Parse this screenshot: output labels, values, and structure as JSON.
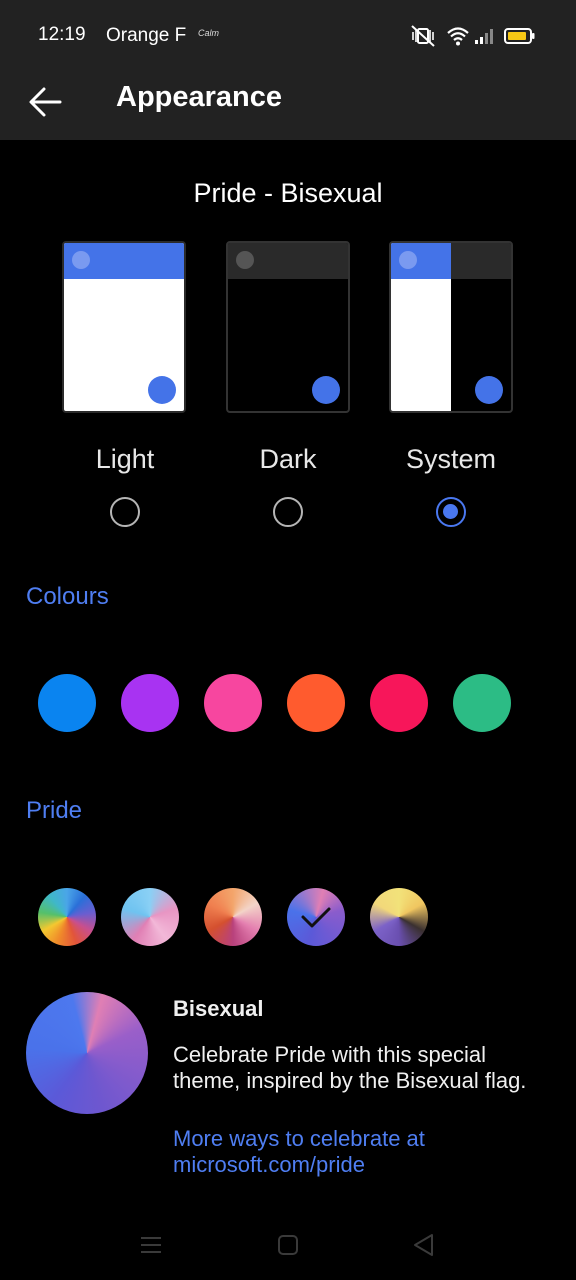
{
  "status_bar": {
    "time": "12:19",
    "carrier": "Orange F",
    "extra": "Calm"
  },
  "app_bar": {
    "title": "Appearance",
    "back_icon": "arrow-left-icon"
  },
  "theme": {
    "current_name": "Pride - Bisexual",
    "options": [
      {
        "label": "Light",
        "selected": false
      },
      {
        "label": "Dark",
        "selected": false
      },
      {
        "label": "System",
        "selected": true
      }
    ]
  },
  "colours": {
    "title": "Colours",
    "swatches": [
      "#0a84f0",
      "#a833f2",
      "#f7469f",
      "#ff5b2e",
      "#f7165a",
      "#2cbc85"
    ]
  },
  "pride": {
    "title": "Pride",
    "swatches": [
      "rainbow",
      "trans",
      "lesbian",
      "bisexual",
      "nonbinary"
    ],
    "selected_index": 3
  },
  "detail": {
    "title": "Bisexual",
    "description": "Celebrate Pride with this special theme, inspired by the Bisexual flag.",
    "link": "More ways to celebrate at microsoft.com/pride"
  },
  "colors": {
    "accent": "#4f7ef2",
    "card_blue": "#4473e8",
    "background": "#000000",
    "bar": "#222222"
  }
}
